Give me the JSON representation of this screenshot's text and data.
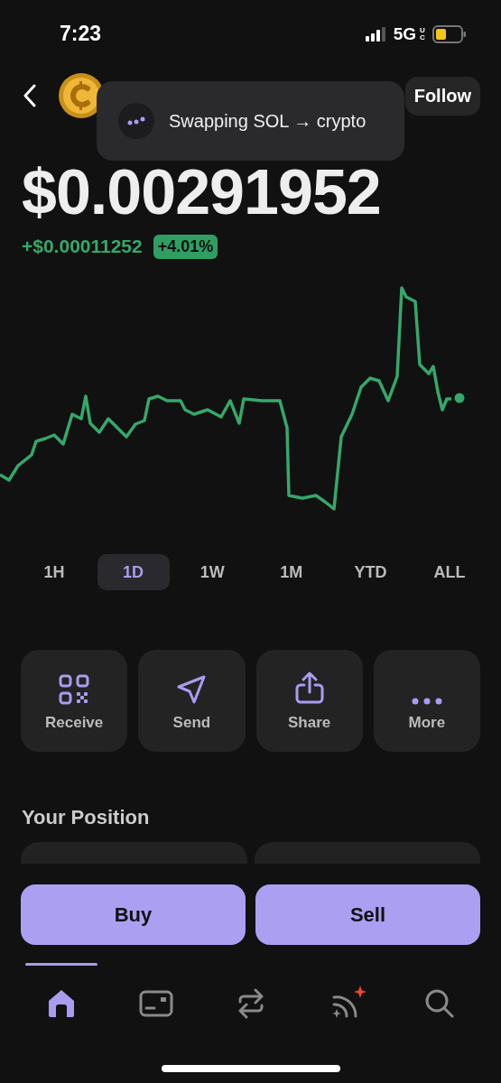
{
  "status_bar": {
    "time": "7:23",
    "network": "5G",
    "network_sup": "UC"
  },
  "header": {
    "follow": "Follow"
  },
  "toast": {
    "text": "Swapping SOL → crypto"
  },
  "price": {
    "value": "$0.00291952",
    "change": "+$0.00011252",
    "percent": "+4.01%"
  },
  "timeframes": [
    {
      "label": "1H",
      "selected": false
    },
    {
      "label": "1D",
      "selected": true
    },
    {
      "label": "1W",
      "selected": false
    },
    {
      "label": "1M",
      "selected": false
    },
    {
      "label": "YTD",
      "selected": false
    },
    {
      "label": "ALL",
      "selected": false
    }
  ],
  "actions": [
    {
      "kind": "receive",
      "label": "Receive"
    },
    {
      "kind": "send",
      "label": "Send"
    },
    {
      "kind": "share",
      "label": "Share"
    },
    {
      "kind": "more",
      "label": "More"
    }
  ],
  "position": {
    "title": "Your Position"
  },
  "trade_buttons": [
    "Buy",
    "Sell"
  ],
  "nav": [
    {
      "kind": "home",
      "selected": true,
      "badge": false
    },
    {
      "kind": "wallet",
      "selected": false,
      "badge": false
    },
    {
      "kind": "swap",
      "selected": false,
      "badge": false
    },
    {
      "kind": "feed",
      "selected": false,
      "badge": true
    },
    {
      "kind": "search",
      "selected": false,
      "badge": false
    }
  ]
}
